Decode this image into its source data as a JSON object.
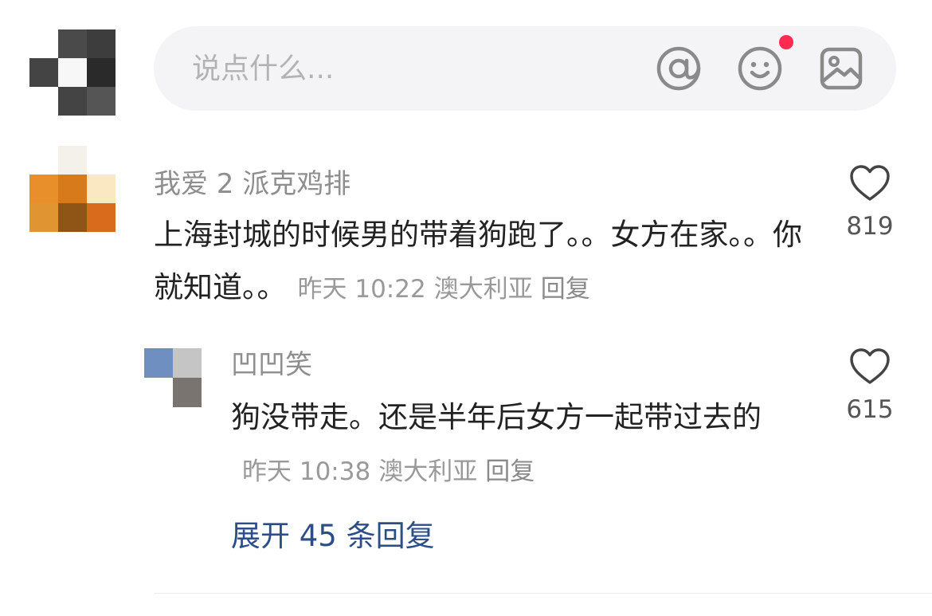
{
  "input": {
    "placeholder": "说点什么...",
    "icons": [
      "at-icon",
      "emoji-icon",
      "image-icon"
    ],
    "emoji_badge_color": "#ff2a4f"
  },
  "comments": [
    {
      "username": "我爱 2 派克鸡排",
      "text": "上海封城的时候男的带着狗跑了。。女方在家。。你就知道。。",
      "time": "昨天 10:22",
      "location": "澳大利亚",
      "reply_label": "回复",
      "likes": "819",
      "replies": [
        {
          "username": "凹凹笑",
          "text": "狗没带走。还是半年后女方一起带过去的",
          "time": "昨天 10:38",
          "location": "澳大利亚",
          "reply_label": "回复",
          "likes": "615"
        }
      ],
      "expand_label": "展开 45 条回复"
    }
  ],
  "colors": {
    "link": "#2c4e86",
    "meta": "#999999",
    "username": "#8e8e8e"
  }
}
